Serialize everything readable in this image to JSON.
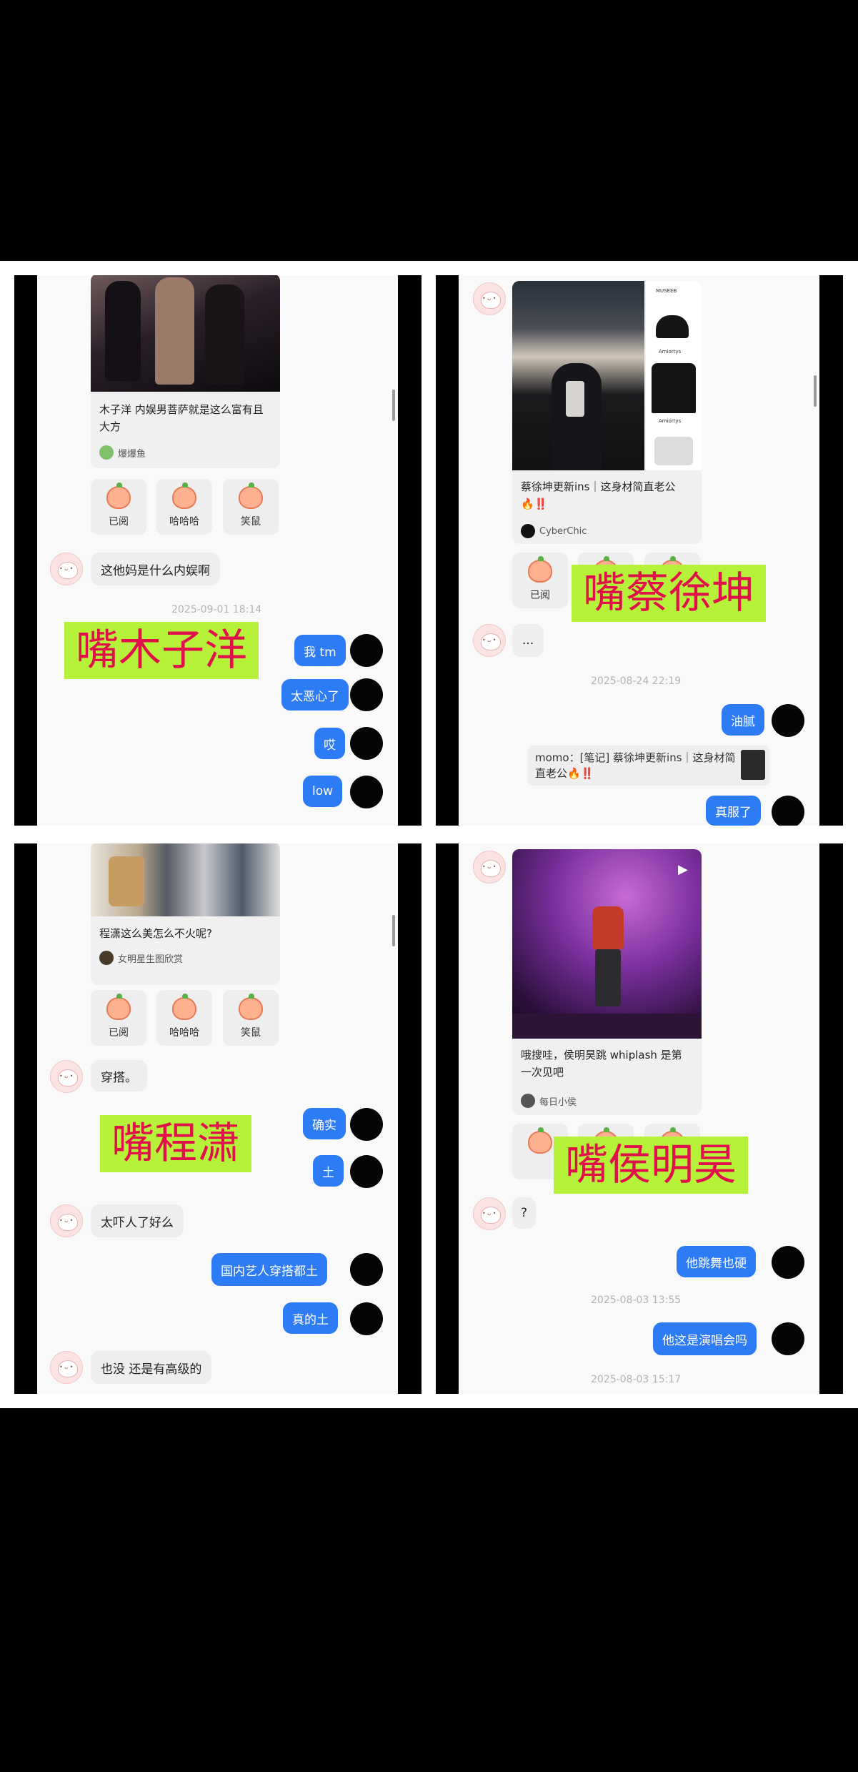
{
  "q1": {
    "card": {
      "title": "木子洋 内娱男菩萨就是这么富有且大方",
      "source": "爆爆鱼"
    },
    "reactions": [
      "已阅",
      "哈哈哈",
      "笑鼠"
    ],
    "msg_in_1": "这他妈是什么内娱啊",
    "timestamp": "2025-09-01 18:14",
    "overlay": "嘴木子洋",
    "out": [
      "我 tm",
      "太恶心了",
      "哎",
      "low"
    ]
  },
  "q2": {
    "card": {
      "title": "蔡徐坤更新ins｜这身材简直老公🔥‼️",
      "source": "CyberChic"
    },
    "reaction": "已阅",
    "overlay": "嘴蔡徐坤",
    "msg_in_1": "...",
    "timestamp": "2025-08-24 22:19",
    "out_1": "油腻",
    "quote": "momo：[笔记] 蔡徐坤更新ins｜这身材简直老公🔥‼️",
    "out_2": "真服了",
    "product_labels": [
      "MUSEEB",
      "Amiortys",
      "Amiortys"
    ]
  },
  "q3": {
    "card": {
      "title": "程潇这么美怎么不火呢?",
      "source": "女明星生图欣赏"
    },
    "reactions": [
      "已阅",
      "哈哈哈",
      "笑鼠"
    ],
    "msg_in_1": "穿搭。",
    "overlay": "嘴程潇",
    "out_1": "确实",
    "out_2": "土",
    "msg_in_2": "太吓人了好么",
    "out_3": "国内艺人穿搭都土",
    "out_4": "真的土",
    "msg_in_3": "也没 还是有高级的"
  },
  "q4": {
    "card": {
      "title": "哦搜哇，侯明昊跳 whiplash 是第一次见吧",
      "source": "每日小侯"
    },
    "overlay": "嘴侯明昊",
    "msg_in_1": "?",
    "out_1": "他跳舞也硬",
    "timestamp_1": "2025-08-03 13:55",
    "out_2": "他这是演唱会吗",
    "timestamp_2": "2025-08-03 15:17"
  },
  "colors": {
    "bubble_out": "#2d7cf6",
    "bubble_in": "#eeeeee",
    "overlay_bg": "#b6f23a",
    "overlay_text": "#e0104a"
  }
}
